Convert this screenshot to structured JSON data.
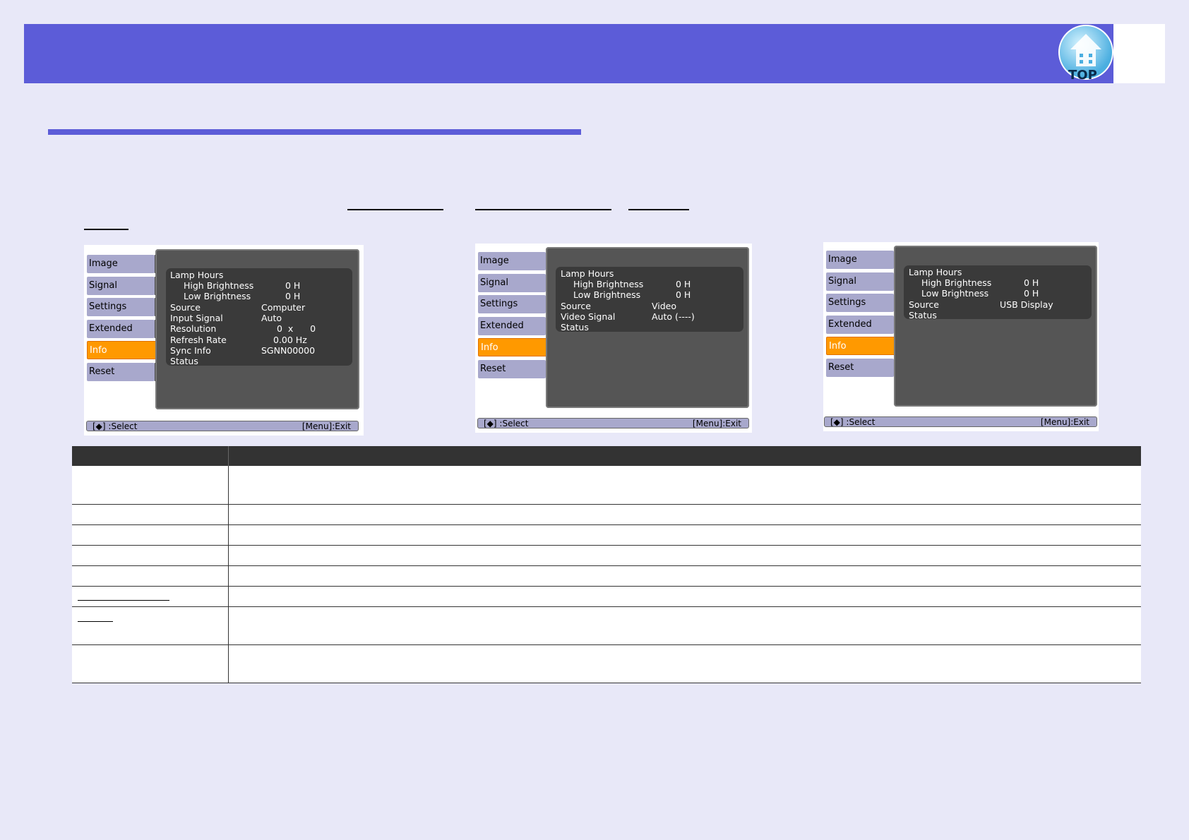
{
  "header": {
    "top_badge_label": "TOP",
    "colors": {
      "bar": "#5c5cd8",
      "badge": "#6cc0e8"
    }
  },
  "osd_screens": [
    {
      "menu": [
        "Image",
        "Signal",
        "Settings",
        "Extended",
        "Info",
        "Reset"
      ],
      "active": "Info",
      "rows": [
        {
          "key": "Lamp Hours",
          "value": ""
        },
        {
          "key": "High Brightness",
          "value": "0 H"
        },
        {
          "key": "Low Brightness",
          "value": "0 H"
        },
        {
          "key": "Source",
          "value": "Computer"
        },
        {
          "key": "Input Signal",
          "value": "Auto"
        },
        {
          "key": "Resolution",
          "value": "0  x      0"
        },
        {
          "key": "Refresh Rate",
          "value": "0.00 Hz"
        },
        {
          "key": "Sync Info",
          "value": "SGNN00000"
        },
        {
          "key": "Status",
          "value": ""
        }
      ],
      "footer_left": "[◆] :Select",
      "footer_right": "[Menu]:Exit"
    },
    {
      "menu": [
        "Image",
        "Signal",
        "Settings",
        "Extended",
        "Info",
        "Reset"
      ],
      "active": "Info",
      "rows": [
        {
          "key": "Lamp Hours",
          "value": ""
        },
        {
          "key": "High Brightness",
          "value": "0 H"
        },
        {
          "key": "Low Brightness",
          "value": "0 H"
        },
        {
          "key": "Source",
          "value": "Video"
        },
        {
          "key": "Video Signal",
          "value": "Auto (----)"
        },
        {
          "key": "Status",
          "value": ""
        }
      ],
      "footer_left": "[◆] :Select",
      "footer_right": "[Menu]:Exit"
    },
    {
      "menu": [
        "Image",
        "Signal",
        "Settings",
        "Extended",
        "Info",
        "Reset"
      ],
      "active": "Info",
      "rows": [
        {
          "key": "Lamp Hours",
          "value": ""
        },
        {
          "key": "High Brightness",
          "value": "0 H"
        },
        {
          "key": "Low Brightness",
          "value": "0 H"
        },
        {
          "key": "Source",
          "value": "USB Display"
        },
        {
          "key": "Status",
          "value": ""
        }
      ],
      "footer_left": "[◆] :Select",
      "footer_right": "[Menu]:Exit"
    }
  ]
}
